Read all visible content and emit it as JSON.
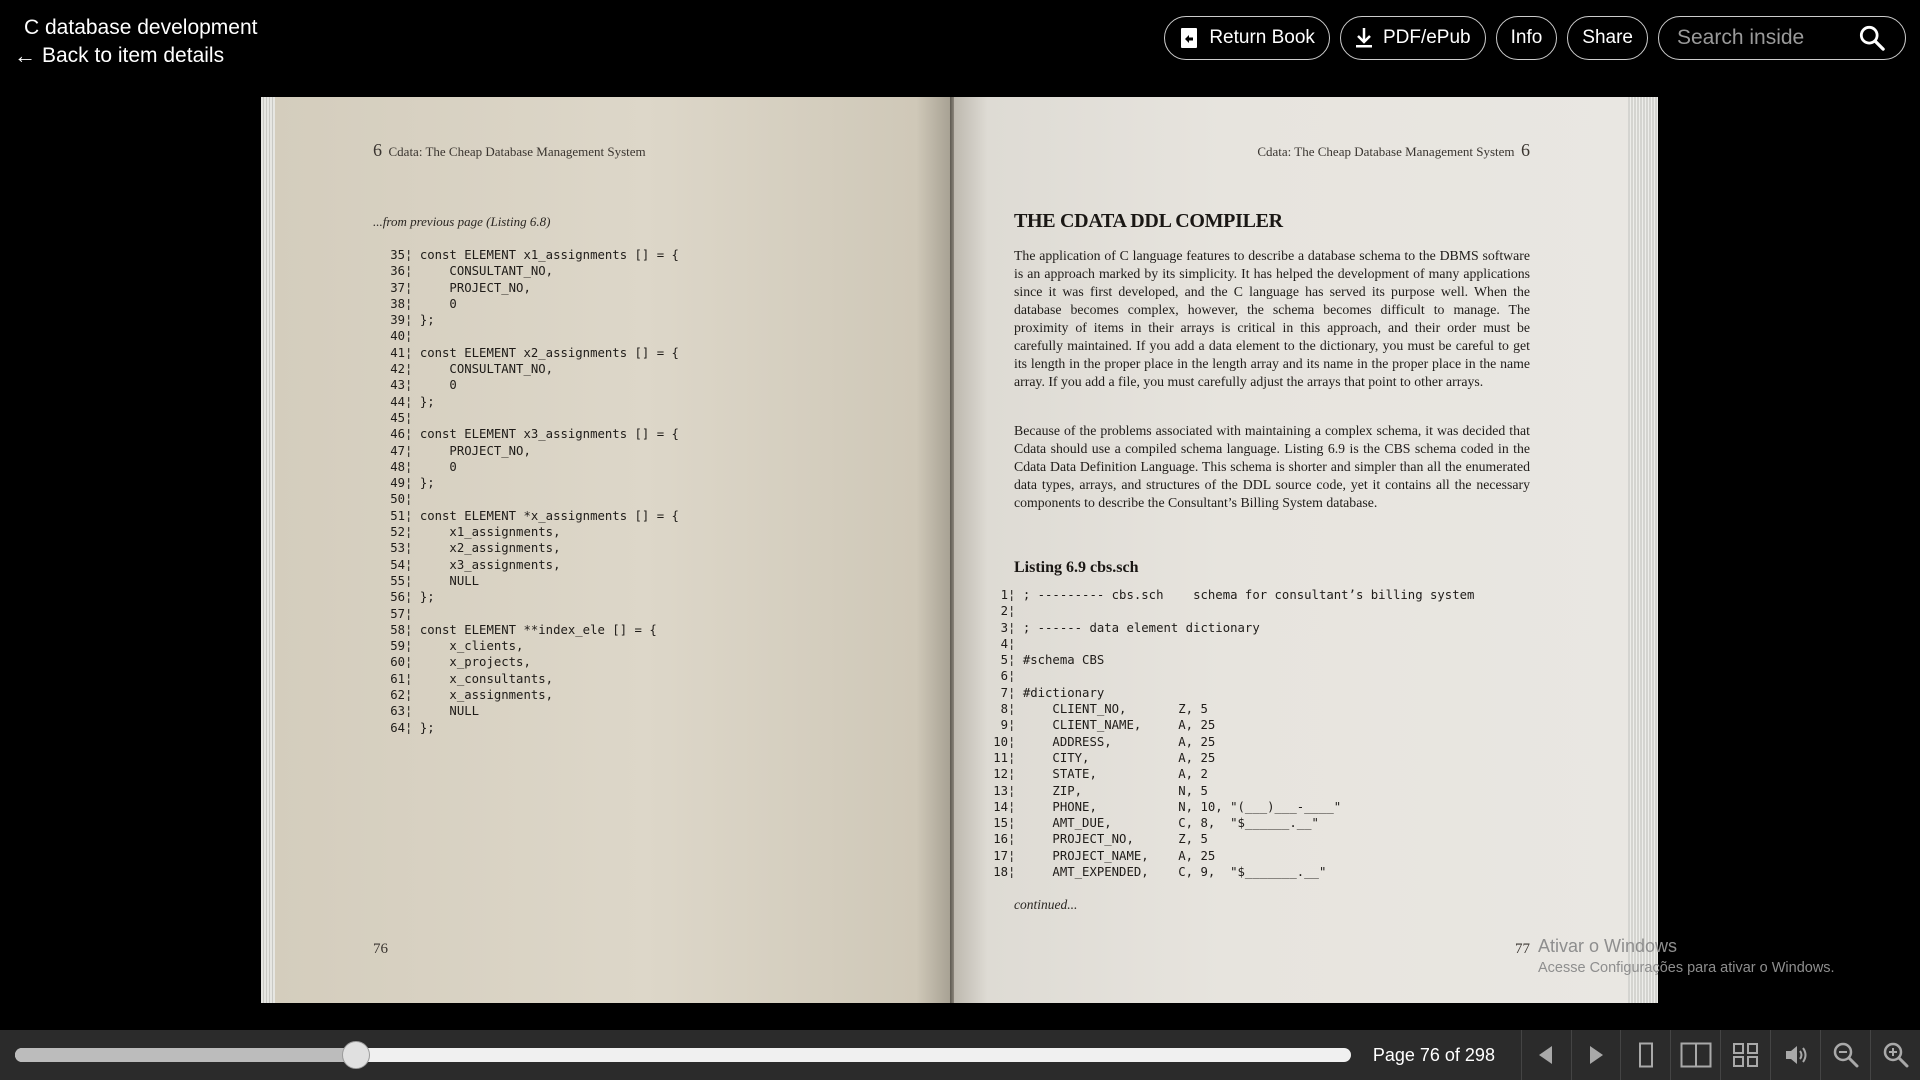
{
  "header": {
    "title": "C database development",
    "back_label": "Back to item details",
    "actions": {
      "return_book": "Return Book",
      "download": "PDF/ePub",
      "info": "Info",
      "share": "Share"
    },
    "search_placeholder": "Search inside"
  },
  "book": {
    "left_page": {
      "chapter_num": "6",
      "running_head": "Cdata: The Cheap Database Management System",
      "from_previous": "...from previous page (Listing 6.8)",
      "code": [
        [
          "35",
          "const ELEMENT x1_assignments [] = {"
        ],
        [
          "36",
          "    CONSULTANT_NO,"
        ],
        [
          "37",
          "    PROJECT_NO,"
        ],
        [
          "38",
          "    0"
        ],
        [
          "39",
          "};"
        ],
        [
          "40",
          ""
        ],
        [
          "41",
          "const ELEMENT x2_assignments [] = {"
        ],
        [
          "42",
          "    CONSULTANT_NO,"
        ],
        [
          "43",
          "    0"
        ],
        [
          "44",
          "};"
        ],
        [
          "45",
          ""
        ],
        [
          "46",
          "const ELEMENT x3_assignments [] = {"
        ],
        [
          "47",
          "    PROJECT_NO,"
        ],
        [
          "48",
          "    0"
        ],
        [
          "49",
          "};"
        ],
        [
          "50",
          ""
        ],
        [
          "51",
          "const ELEMENT *x_assignments [] = {"
        ],
        [
          "52",
          "    x1_assignments,"
        ],
        [
          "53",
          "    x2_assignments,"
        ],
        [
          "54",
          "    x3_assignments,"
        ],
        [
          "55",
          "    NULL"
        ],
        [
          "56",
          "};"
        ],
        [
          "57",
          ""
        ],
        [
          "58",
          "const ELEMENT **index_ele [] = {"
        ],
        [
          "59",
          "    x_clients,"
        ],
        [
          "60",
          "    x_projects,"
        ],
        [
          "61",
          "    x_consultants,"
        ],
        [
          "62",
          "    x_assignments,"
        ],
        [
          "63",
          "    NULL"
        ],
        [
          "64",
          "};"
        ]
      ],
      "page_number": "76"
    },
    "right_page": {
      "running_head": "Cdata: The Cheap Database Management System",
      "chapter_num": "6",
      "section_title": "THE CDATA DDL COMPILER",
      "paragraph1": "The application of C language features to describe a database schema to the DBMS software is an approach marked by its simplicity. It has helped the development of many applications since it was first developed, and the C language has served its purpose well. When the database becomes complex, however, the schema becomes difficult to manage. The proximity of items in their arrays is critical in this approach, and their order must be carefully maintained. If you add a data element to the dictionary, you must be careful to get its length in the proper place in the length array and its name in the proper place in the name array. If you add a file, you must carefully adjust the arrays that point to other arrays.",
      "paragraph2": "Because of the problems associated with maintaining a complex schema, it was decided that Cdata should use a compiled schema language. Listing 6.9 is the CBS schema coded in the Cdata Data Definition Language. This schema is shorter and simpler than all the enumerated data types, arrays, and structures of the DDL source code, yet it contains all the necessary components to describe the Consultant’s Billing System database.",
      "listing_title": "Listing 6.9 cbs.sch",
      "code": [
        [
          "1",
          "; --------- cbs.sch    schema for consultant’s billing system"
        ],
        [
          "2",
          ""
        ],
        [
          "3",
          "; ------ data element dictionary"
        ],
        [
          "4",
          ""
        ],
        [
          "5",
          "#schema CBS"
        ],
        [
          "6",
          ""
        ],
        [
          "7",
          "#dictionary"
        ],
        [
          "8",
          "    CLIENT_NO,       Z, 5"
        ],
        [
          "9",
          "    CLIENT_NAME,     A, 25"
        ],
        [
          "10",
          "    ADDRESS,         A, 25"
        ],
        [
          "11",
          "    CITY,            A, 25"
        ],
        [
          "12",
          "    STATE,           A, 2"
        ],
        [
          "13",
          "    ZIP,             N, 5"
        ],
        [
          "14",
          "    PHONE,           N, 10, \"(___)___-____\""
        ],
        [
          "15",
          "    AMT_DUE,         C, 8,  \"$______.__\""
        ],
        [
          "16",
          "    PROJECT_NO,      Z, 5"
        ],
        [
          "17",
          "    PROJECT_NAME,    A, 25"
        ],
        [
          "18",
          "    AMT_EXPENDED,    C, 9,  \"$_______.__\""
        ]
      ],
      "continued": "continued...",
      "page_number": "77"
    }
  },
  "watermark": {
    "line1": "Ativar o Windows",
    "line2": "Acesse Configurações para ativar o Windows."
  },
  "footer": {
    "page_indicator": "Page 76 of 298",
    "progress_fraction": 0.255,
    "controls": [
      {
        "name": "prev-page-icon"
      },
      {
        "name": "next-page-icon"
      },
      {
        "name": "one-page-view-icon"
      },
      {
        "name": "two-page-view-icon"
      },
      {
        "name": "thumbnail-view-icon"
      },
      {
        "name": "read-aloud-icon"
      },
      {
        "name": "zoom-out-icon"
      },
      {
        "name": "zoom-in-icon"
      }
    ]
  }
}
